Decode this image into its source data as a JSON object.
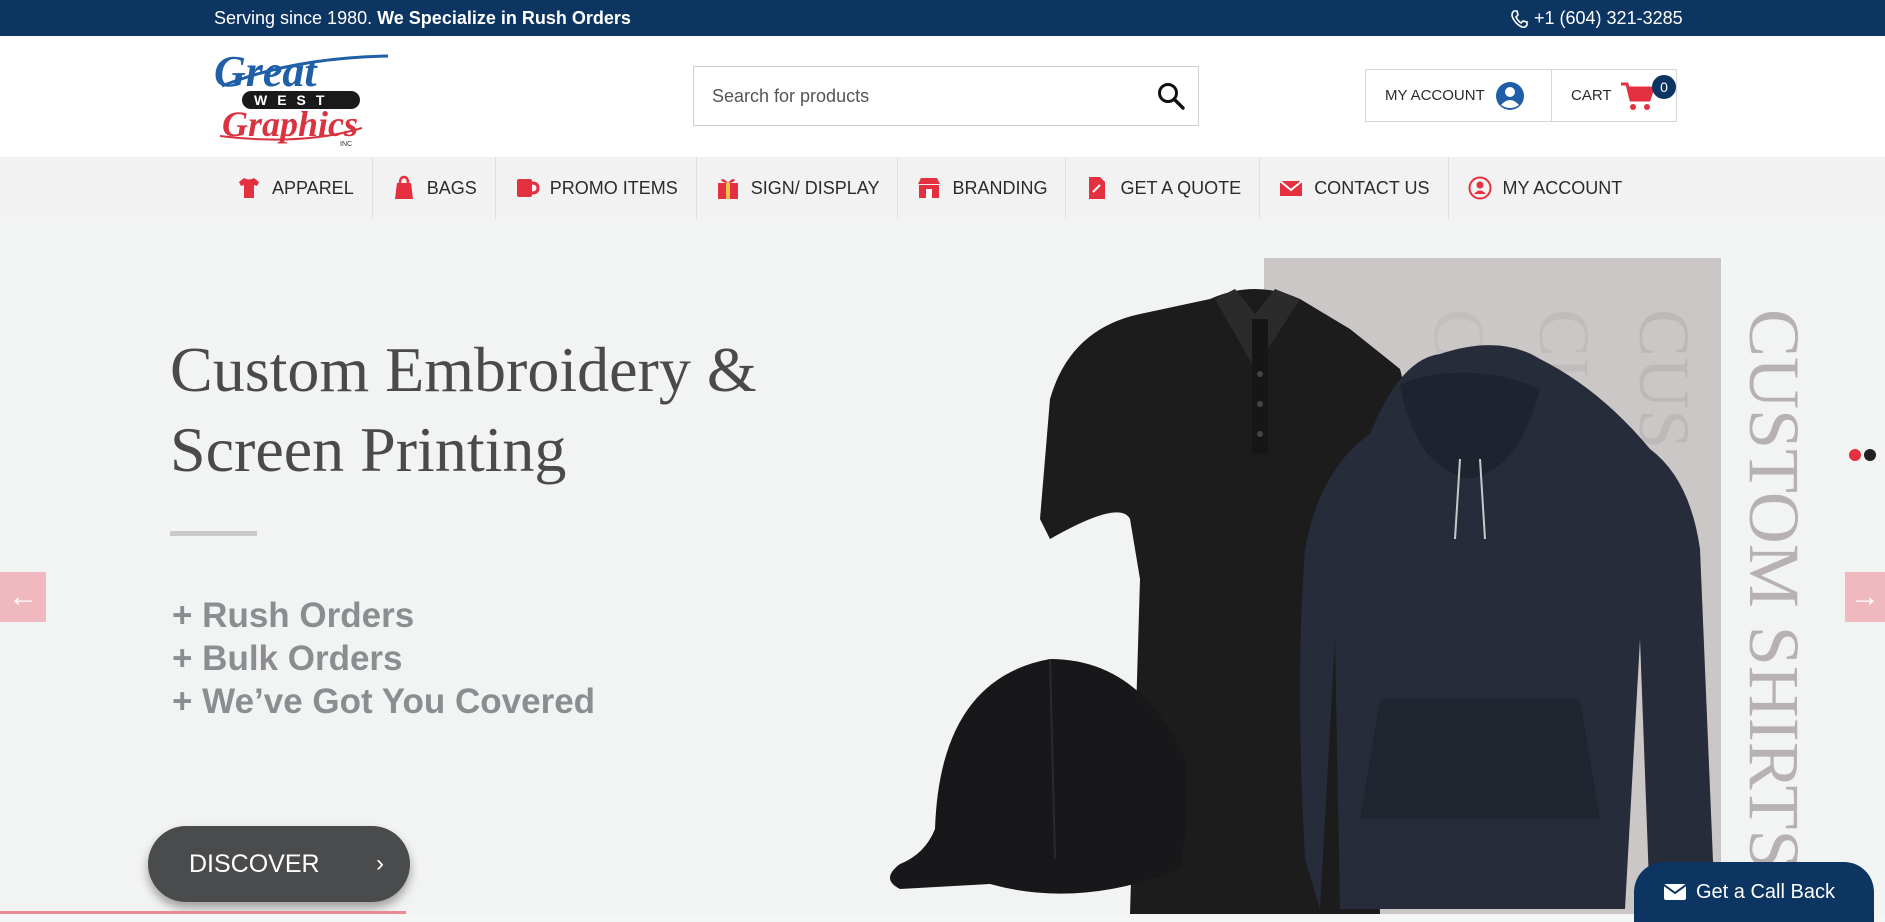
{
  "topbar": {
    "tagline": "Serving since 1980.",
    "tagline_bold": "We Specialize in Rush Orders",
    "phone": "+1 (604) 321-3285",
    "phone_icon": "phone-icon"
  },
  "header": {
    "logo_alt": "Great West Graphics Inc",
    "search_placeholder": "Search for products",
    "account_label": "MY ACCOUNT",
    "cart_label": "CART",
    "cart_count": "0"
  },
  "nav": {
    "items": [
      {
        "label": "APPAREL",
        "icon": "shirt-icon"
      },
      {
        "label": "BAGS",
        "icon": "bag-icon"
      },
      {
        "label": "PROMO ITEMS",
        "icon": "mug-icon"
      },
      {
        "label": "SIGN/ DISPLAY",
        "icon": "display-icon"
      },
      {
        "label": "BRANDING",
        "icon": "storefront-icon"
      },
      {
        "label": "GET A QUOTE",
        "icon": "document-icon"
      },
      {
        "label": "CONTACT US",
        "icon": "envelope-icon"
      },
      {
        "label": "MY ACCOUNT",
        "icon": "user-icon"
      }
    ]
  },
  "hero": {
    "title_line1": "Custom Embroidery &",
    "title_line2": "Screen Printing",
    "bullets": [
      "+ Rush Orders",
      "+ Bulk Orders",
      "+ We’ve Got You Covered"
    ],
    "cta": "DISCOVER",
    "backdrop_text": "CUSTOM SHIRTS"
  },
  "callback": {
    "label": "Get a Call Back"
  },
  "colors": {
    "brand_navy": "#0d3562",
    "brand_red": "#e53040",
    "hero_bg": "#f2f3f3"
  }
}
